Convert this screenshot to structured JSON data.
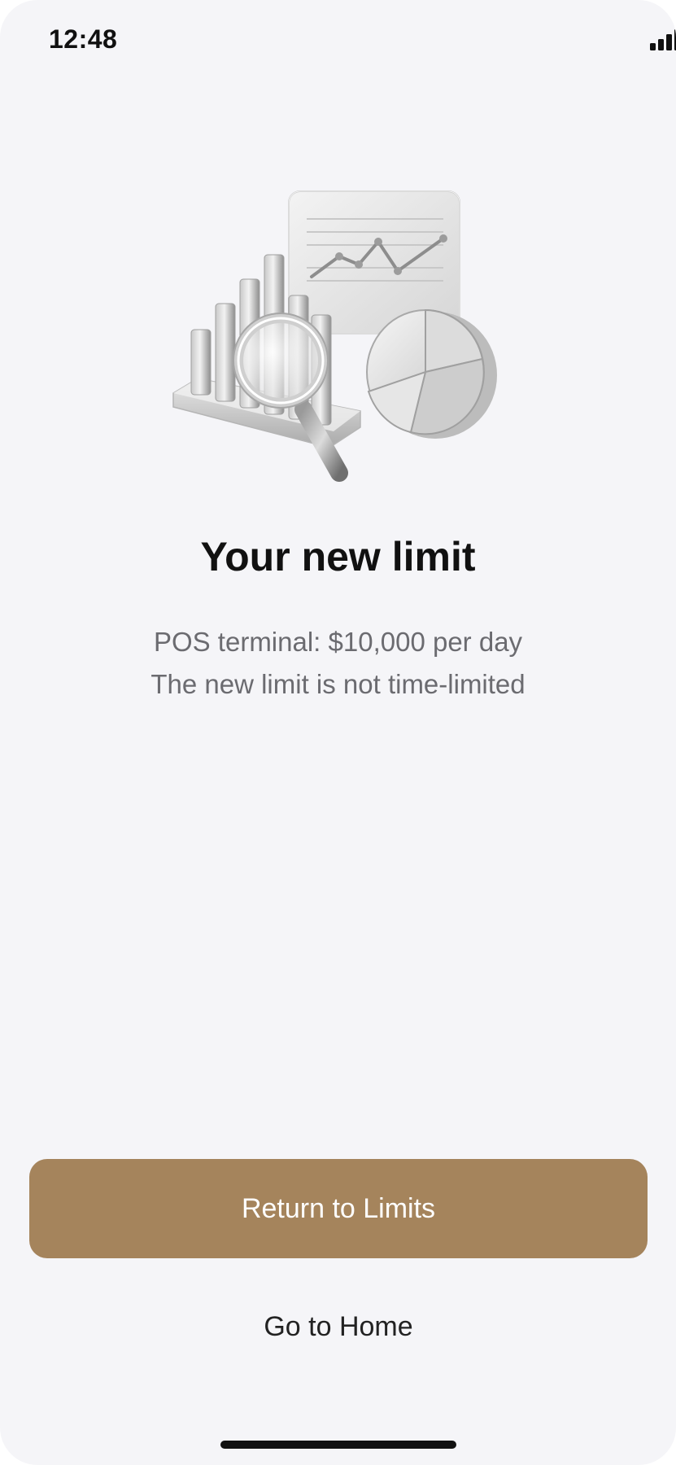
{
  "status_bar": {
    "time": "12:48",
    "icons": [
      "signal-icon",
      "wifi-icon",
      "battery-icon"
    ]
  },
  "illustration": {
    "name": "analytics-illustration",
    "description_icon": "charts-magnifier-icon"
  },
  "content": {
    "title": "Your new limit",
    "line1": "POS terminal: $10,000 per day",
    "line2": "The new limit is not time-limited"
  },
  "actions": {
    "primary_label": "Return to Limits",
    "secondary_label": "Go to Home"
  },
  "colors": {
    "background": "#f5f5f8",
    "accent": "#a5845c",
    "title": "#111111",
    "subtitle": "#6b6b70"
  }
}
